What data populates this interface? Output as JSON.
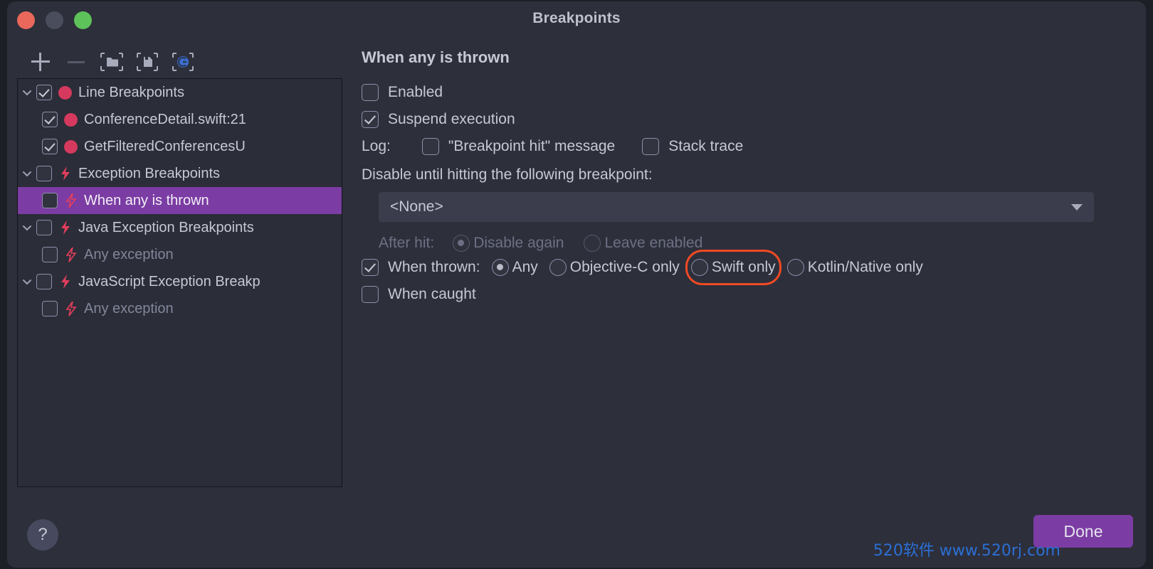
{
  "window": {
    "title": "Breakpoints",
    "traffic_lights": [
      "close",
      "minimize",
      "maximize"
    ]
  },
  "toolbar": {
    "buttons": [
      {
        "name": "add-breakpoint",
        "icon": "plus-icon",
        "label": "+"
      },
      {
        "name": "remove-breakpoint",
        "icon": "minus-icon",
        "label": "–"
      },
      {
        "name": "group-breakpoints",
        "icon": "folder-icon",
        "label": ""
      },
      {
        "name": "save-breakpoints",
        "icon": "save-icon",
        "label": ""
      },
      {
        "name": "mute-breakpoints",
        "icon": "circle-c-icon",
        "label": ""
      }
    ]
  },
  "tree": [
    {
      "label": "Line Breakpoints",
      "twisty": "expanded",
      "checked": true,
      "icon": "breakpoint-dot",
      "indent": 0,
      "selected": false,
      "dim": false
    },
    {
      "label": "ConferenceDetail.swift:21",
      "twisty": "none",
      "checked": true,
      "icon": "breakpoint-dot",
      "indent": 1,
      "selected": false,
      "dim": false
    },
    {
      "label": "GetFilteredConferencesU",
      "twisty": "none",
      "checked": true,
      "icon": "breakpoint-dot",
      "indent": 1,
      "selected": false,
      "dim": false
    },
    {
      "label": "Exception Breakpoints",
      "twisty": "expanded",
      "checked": false,
      "icon": "bolt",
      "indent": 0,
      "selected": false,
      "dim": false
    },
    {
      "label": "When any is thrown",
      "twisty": "none",
      "checked": false,
      "icon": "bolt-outline",
      "indent": 1,
      "selected": true,
      "dim": false
    },
    {
      "label": "Java Exception Breakpoints",
      "twisty": "expanded",
      "checked": false,
      "icon": "bolt",
      "indent": 0,
      "selected": false,
      "dim": false
    },
    {
      "label": "Any exception",
      "twisty": "none",
      "checked": false,
      "icon": "bolt-outline",
      "indent": 1,
      "selected": false,
      "dim": true
    },
    {
      "label": "JavaScript Exception Breakp",
      "twisty": "expanded",
      "checked": false,
      "icon": "bolt",
      "indent": 0,
      "selected": false,
      "dim": false
    },
    {
      "label": "Any exception",
      "twisty": "none",
      "checked": false,
      "icon": "bolt-outline",
      "indent": 1,
      "selected": false,
      "dim": true
    }
  ],
  "detail": {
    "title": "When any is thrown",
    "enabled": {
      "label": "Enabled",
      "checked": false
    },
    "suspend": {
      "label": "Suspend execution",
      "checked": true
    },
    "log": {
      "prefix": "Log:",
      "message": {
        "label": "\"Breakpoint hit\" message",
        "checked": false
      },
      "stack_trace": {
        "label": "Stack trace",
        "checked": false
      }
    },
    "disable_until": {
      "label": "Disable until hitting the following breakpoint:",
      "value": "<None>",
      "options": [
        "<None>"
      ]
    },
    "after_hit": {
      "label": "After hit:",
      "disabled": true,
      "options": [
        {
          "label": "Disable again",
          "selected": true
        },
        {
          "label": "Leave enabled",
          "selected": false
        }
      ]
    },
    "when_thrown": {
      "label": "When thrown:",
      "checked": true,
      "options": [
        {
          "label": "Any",
          "selected": true,
          "highlighted": false
        },
        {
          "label": "Objective-C only",
          "selected": false,
          "highlighted": false
        },
        {
          "label": "Swift only",
          "selected": false,
          "highlighted": true
        },
        {
          "label": "Kotlin/Native only",
          "selected": false,
          "highlighted": false
        }
      ]
    },
    "when_caught": {
      "label": "When caught",
      "checked": false
    }
  },
  "footer": {
    "help_label": "?",
    "done_label": "Done",
    "watermark": "520软件 www.520rj.com"
  },
  "colors": {
    "window_bg": "#2d2f3b",
    "panel_bg": "#2b2d38",
    "selection": "#7b3ca3",
    "breakpoint_red": "#d5395e",
    "bolt_red": "#e33e5c",
    "accent_button": "#7b3ca3",
    "highlight_outline": "#f04a23",
    "watermark_blue": "#2b6fd4",
    "text_primary": "#c6c9d4",
    "text_dim": "#6d7084"
  }
}
